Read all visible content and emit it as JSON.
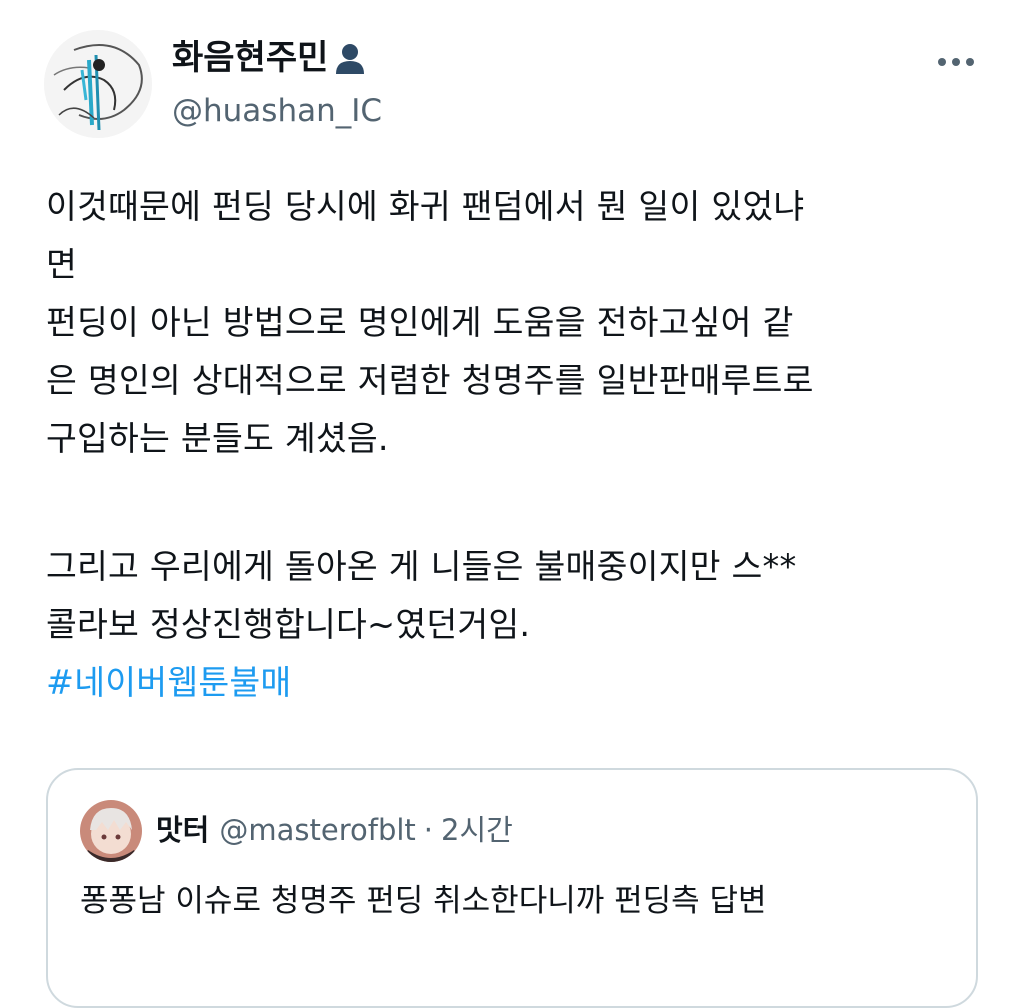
{
  "tweet": {
    "author": {
      "name": "화음현주민",
      "handle": "@huashan_IC",
      "avatar_icon": "sketch-avatar",
      "badge_icon": "bust-silhouette-icon"
    },
    "more_icon": "more-options-icon",
    "lines": [
      "이것때문에 펀딩 당시에 화귀 팬덤에서 뭔 일이 있었냐",
      "면",
      "펀딩이 아닌 방법으로 명인에게 도움을 전하고싶어 같",
      "은 명인의 상대적으로 저렴한 청명주를 일반판매루트로",
      "구입하는 분들도 계셨음.",
      "그리고 우리에게 돌아온 게 니들은 불매중이지만 스**",
      "콜라보 정상진행합니다~였던거임."
    ],
    "hashtag": "#네이버웹툰불매",
    "accent_color": "#1d9bf0"
  },
  "quote": {
    "name": "맛터",
    "handle": "@masterofblt",
    "separator": "·",
    "time": "2시간",
    "text": "퐁퐁남 이슈로 청명주 펀딩 취소한다니까 펀딩측 답변",
    "avatar_icon": "anime-avatar"
  }
}
